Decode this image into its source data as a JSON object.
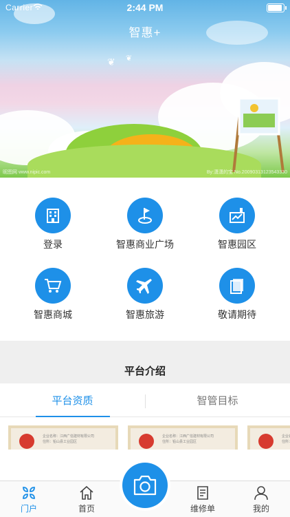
{
  "status_bar": {
    "carrier": "Carrier",
    "time": "2:44 PM",
    "battery_level": 0.9
  },
  "header": {
    "app_title": "智惠+"
  },
  "hero": {
    "watermark_left": "昵图网 www.nipic.com",
    "watermark_right": "By:潇潇的宝 No.20090313123543330"
  },
  "menu": {
    "items": [
      {
        "label": "登录",
        "icon": "building-icon"
      },
      {
        "label": "智惠商业广场",
        "icon": "golf-flag-icon"
      },
      {
        "label": "智惠园区",
        "icon": "factory-icon"
      },
      {
        "label": "智惠商城",
        "icon": "shopping-cart-icon"
      },
      {
        "label": "智惠旅游",
        "icon": "airplane-icon"
      },
      {
        "label": "敬请期待",
        "icon": "stacked-pages-icon"
      }
    ]
  },
  "intro": {
    "section_title": "平台介绍",
    "tabs": [
      {
        "label": "平台资质",
        "active": true
      },
      {
        "label": "智管目标",
        "active": false
      }
    ],
    "certificates": [
      {
        "company": "企业名称：江西广信建材有限公司",
        "address": "住所：铅山县工业园区"
      },
      {
        "company": "企业名称：江西广信建材有限公司",
        "address": "住所：铅山县工业园区"
      },
      {
        "company": "企业名称：江西广信建材有限公司",
        "address": "住所：铅山县工业园区"
      }
    ]
  },
  "tabbar": {
    "items": [
      {
        "label": "门户",
        "icon": "portal-grid-icon",
        "active": true
      },
      {
        "label": "首页",
        "icon": "home-icon",
        "active": false
      },
      {
        "label": "",
        "icon": "camera-icon",
        "active": false
      },
      {
        "label": "维修单",
        "icon": "document-icon",
        "active": false
      },
      {
        "label": "我的",
        "icon": "user-icon",
        "active": false
      }
    ]
  },
  "colors": {
    "accent": "#1e90e8",
    "band": "#efefef"
  }
}
